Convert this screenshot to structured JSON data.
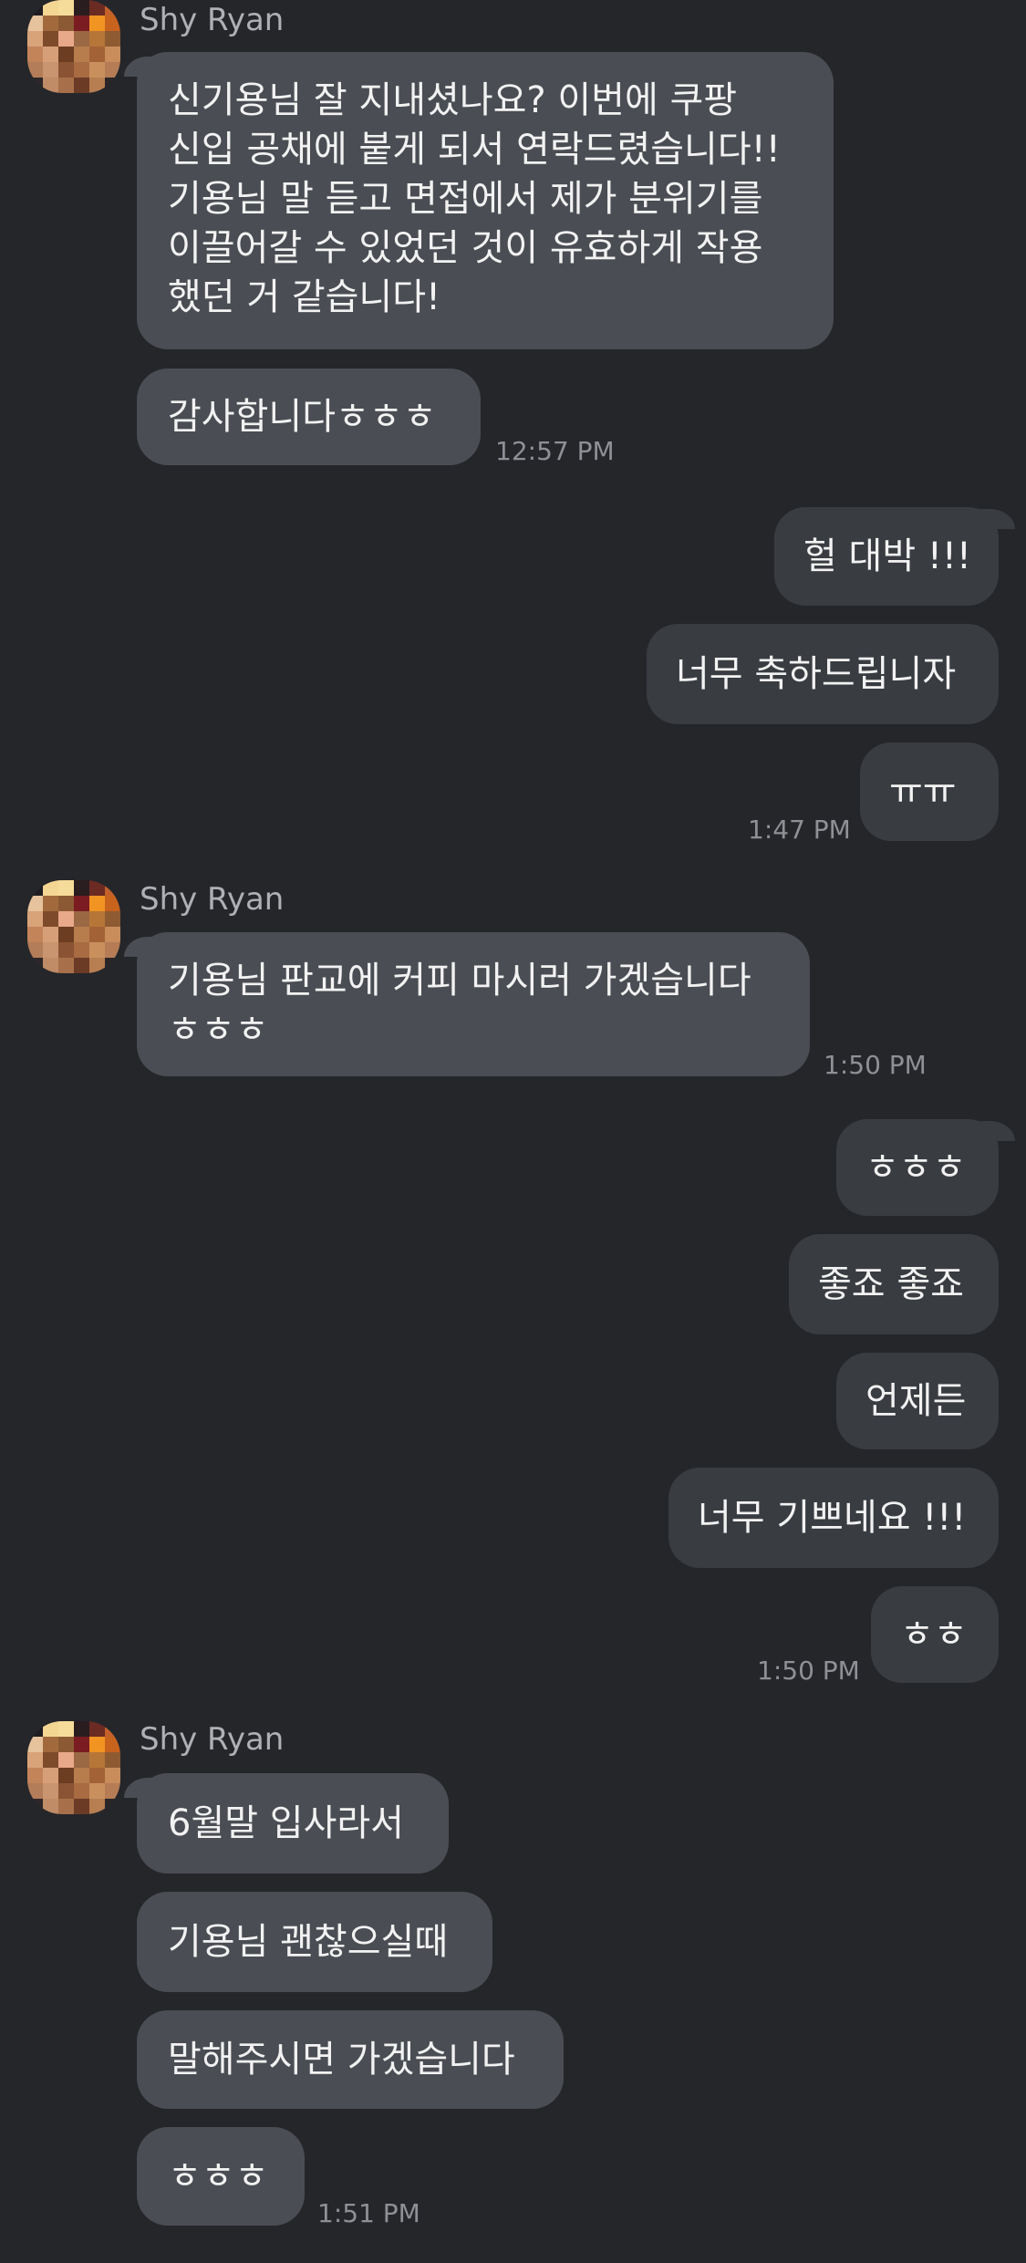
{
  "sender_name": "Shy Ryan",
  "messages": [
    {
      "from": "in",
      "lines": [
        "신기용님 잘 지내셨나요? 이번에 쿠팡",
        "신입 공채에 붙게 되서 연락드렸습니다!!",
        "기용님 말 듣고 면접에서 제가 분위기를",
        "이끌어갈 수 있었던 것이 유효하게 작용",
        "했던 거 같습니다!"
      ]
    },
    {
      "from": "in",
      "text": "감사합니다ㅎㅎㅎ",
      "time": "12:57 PM"
    },
    {
      "from": "out",
      "text": "헐 대박 !!!"
    },
    {
      "from": "out",
      "text": "너무 축하드립니자"
    },
    {
      "from": "out",
      "text": "ㅠㅠ",
      "time": "1:47 PM"
    },
    {
      "from": "in",
      "lines": [
        "기용님 판교에 커피 마시러 가겠습니다",
        "ㅎㅎㅎ"
      ],
      "time": "1:50 PM"
    },
    {
      "from": "out",
      "text": "ㅎㅎㅎ"
    },
    {
      "from": "out",
      "text": "좋죠 좋죠"
    },
    {
      "from": "out",
      "text": "언제든"
    },
    {
      "from": "out",
      "text": "너무 기쁘네요 !!!"
    },
    {
      "from": "out",
      "text": "ㅎㅎ",
      "time": "1:50 PM"
    },
    {
      "from": "in",
      "text": "6월말 입사라서"
    },
    {
      "from": "in",
      "text": "기용님 괜찮으실때"
    },
    {
      "from": "in",
      "text": "말해주시면 가겠습니다"
    },
    {
      "from": "in",
      "text": "ㅎㅎㅎ",
      "time": "1:51 PM"
    }
  ],
  "colors": {
    "background": "#25262a",
    "incoming_bubble": "#4a4d53",
    "outgoing_bubble": "#393c41",
    "text": "#f2f2f2",
    "timestamp": "#8e9096"
  },
  "avatar_icon": "pixelated-avatar-icon"
}
